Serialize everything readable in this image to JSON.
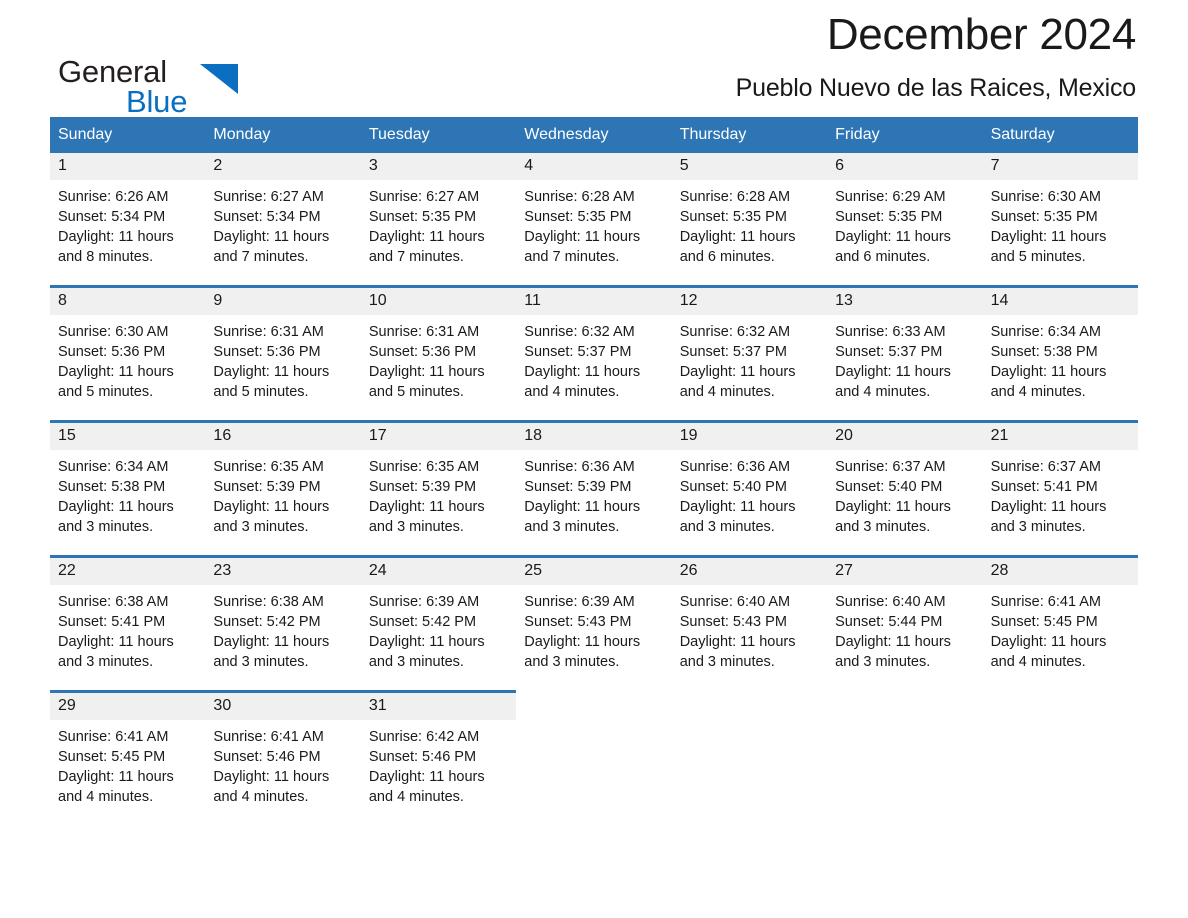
{
  "brand": {
    "name_part1": "General",
    "name_part2": "Blue",
    "logo_icon": "triangle-flag-icon",
    "accent_color": "#0a6ec1"
  },
  "header": {
    "title": "December 2024",
    "location": "Pueblo Nuevo de las Raices, Mexico"
  },
  "calendar": {
    "header_color": "#2e75b6",
    "daynum_band_color": "#f0f0f0",
    "weekdays": [
      "Sunday",
      "Monday",
      "Tuesday",
      "Wednesday",
      "Thursday",
      "Friday",
      "Saturday"
    ],
    "weeks": [
      [
        {
          "day": "1",
          "sunrise": "Sunrise: 6:26 AM",
          "sunset": "Sunset: 5:34 PM",
          "daylight_line1": "Daylight: 11 hours",
          "daylight_line2": "and 8 minutes."
        },
        {
          "day": "2",
          "sunrise": "Sunrise: 6:27 AM",
          "sunset": "Sunset: 5:34 PM",
          "daylight_line1": "Daylight: 11 hours",
          "daylight_line2": "and 7 minutes."
        },
        {
          "day": "3",
          "sunrise": "Sunrise: 6:27 AM",
          "sunset": "Sunset: 5:35 PM",
          "daylight_line1": "Daylight: 11 hours",
          "daylight_line2": "and 7 minutes."
        },
        {
          "day": "4",
          "sunrise": "Sunrise: 6:28 AM",
          "sunset": "Sunset: 5:35 PM",
          "daylight_line1": "Daylight: 11 hours",
          "daylight_line2": "and 7 minutes."
        },
        {
          "day": "5",
          "sunrise": "Sunrise: 6:28 AM",
          "sunset": "Sunset: 5:35 PM",
          "daylight_line1": "Daylight: 11 hours",
          "daylight_line2": "and 6 minutes."
        },
        {
          "day": "6",
          "sunrise": "Sunrise: 6:29 AM",
          "sunset": "Sunset: 5:35 PM",
          "daylight_line1": "Daylight: 11 hours",
          "daylight_line2": "and 6 minutes."
        },
        {
          "day": "7",
          "sunrise": "Sunrise: 6:30 AM",
          "sunset": "Sunset: 5:35 PM",
          "daylight_line1": "Daylight: 11 hours",
          "daylight_line2": "and 5 minutes."
        }
      ],
      [
        {
          "day": "8",
          "sunrise": "Sunrise: 6:30 AM",
          "sunset": "Sunset: 5:36 PM",
          "daylight_line1": "Daylight: 11 hours",
          "daylight_line2": "and 5 minutes."
        },
        {
          "day": "9",
          "sunrise": "Sunrise: 6:31 AM",
          "sunset": "Sunset: 5:36 PM",
          "daylight_line1": "Daylight: 11 hours",
          "daylight_line2": "and 5 minutes."
        },
        {
          "day": "10",
          "sunrise": "Sunrise: 6:31 AM",
          "sunset": "Sunset: 5:36 PM",
          "daylight_line1": "Daylight: 11 hours",
          "daylight_line2": "and 5 minutes."
        },
        {
          "day": "11",
          "sunrise": "Sunrise: 6:32 AM",
          "sunset": "Sunset: 5:37 PM",
          "daylight_line1": "Daylight: 11 hours",
          "daylight_line2": "and 4 minutes."
        },
        {
          "day": "12",
          "sunrise": "Sunrise: 6:32 AM",
          "sunset": "Sunset: 5:37 PM",
          "daylight_line1": "Daylight: 11 hours",
          "daylight_line2": "and 4 minutes."
        },
        {
          "day": "13",
          "sunrise": "Sunrise: 6:33 AM",
          "sunset": "Sunset: 5:37 PM",
          "daylight_line1": "Daylight: 11 hours",
          "daylight_line2": "and 4 minutes."
        },
        {
          "day": "14",
          "sunrise": "Sunrise: 6:34 AM",
          "sunset": "Sunset: 5:38 PM",
          "daylight_line1": "Daylight: 11 hours",
          "daylight_line2": "and 4 minutes."
        }
      ],
      [
        {
          "day": "15",
          "sunrise": "Sunrise: 6:34 AM",
          "sunset": "Sunset: 5:38 PM",
          "daylight_line1": "Daylight: 11 hours",
          "daylight_line2": "and 3 minutes."
        },
        {
          "day": "16",
          "sunrise": "Sunrise: 6:35 AM",
          "sunset": "Sunset: 5:39 PM",
          "daylight_line1": "Daylight: 11 hours",
          "daylight_line2": "and 3 minutes."
        },
        {
          "day": "17",
          "sunrise": "Sunrise: 6:35 AM",
          "sunset": "Sunset: 5:39 PM",
          "daylight_line1": "Daylight: 11 hours",
          "daylight_line2": "and 3 minutes."
        },
        {
          "day": "18",
          "sunrise": "Sunrise: 6:36 AM",
          "sunset": "Sunset: 5:39 PM",
          "daylight_line1": "Daylight: 11 hours",
          "daylight_line2": "and 3 minutes."
        },
        {
          "day": "19",
          "sunrise": "Sunrise: 6:36 AM",
          "sunset": "Sunset: 5:40 PM",
          "daylight_line1": "Daylight: 11 hours",
          "daylight_line2": "and 3 minutes."
        },
        {
          "day": "20",
          "sunrise": "Sunrise: 6:37 AM",
          "sunset": "Sunset: 5:40 PM",
          "daylight_line1": "Daylight: 11 hours",
          "daylight_line2": "and 3 minutes."
        },
        {
          "day": "21",
          "sunrise": "Sunrise: 6:37 AM",
          "sunset": "Sunset: 5:41 PM",
          "daylight_line1": "Daylight: 11 hours",
          "daylight_line2": "and 3 minutes."
        }
      ],
      [
        {
          "day": "22",
          "sunrise": "Sunrise: 6:38 AM",
          "sunset": "Sunset: 5:41 PM",
          "daylight_line1": "Daylight: 11 hours",
          "daylight_line2": "and 3 minutes."
        },
        {
          "day": "23",
          "sunrise": "Sunrise: 6:38 AM",
          "sunset": "Sunset: 5:42 PM",
          "daylight_line1": "Daylight: 11 hours",
          "daylight_line2": "and 3 minutes."
        },
        {
          "day": "24",
          "sunrise": "Sunrise: 6:39 AM",
          "sunset": "Sunset: 5:42 PM",
          "daylight_line1": "Daylight: 11 hours",
          "daylight_line2": "and 3 minutes."
        },
        {
          "day": "25",
          "sunrise": "Sunrise: 6:39 AM",
          "sunset": "Sunset: 5:43 PM",
          "daylight_line1": "Daylight: 11 hours",
          "daylight_line2": "and 3 minutes."
        },
        {
          "day": "26",
          "sunrise": "Sunrise: 6:40 AM",
          "sunset": "Sunset: 5:43 PM",
          "daylight_line1": "Daylight: 11 hours",
          "daylight_line2": "and 3 minutes."
        },
        {
          "day": "27",
          "sunrise": "Sunrise: 6:40 AM",
          "sunset": "Sunset: 5:44 PM",
          "daylight_line1": "Daylight: 11 hours",
          "daylight_line2": "and 3 minutes."
        },
        {
          "day": "28",
          "sunrise": "Sunrise: 6:41 AM",
          "sunset": "Sunset: 5:45 PM",
          "daylight_line1": "Daylight: 11 hours",
          "daylight_line2": "and 4 minutes."
        }
      ],
      [
        {
          "day": "29",
          "sunrise": "Sunrise: 6:41 AM",
          "sunset": "Sunset: 5:45 PM",
          "daylight_line1": "Daylight: 11 hours",
          "daylight_line2": "and 4 minutes."
        },
        {
          "day": "30",
          "sunrise": "Sunrise: 6:41 AM",
          "sunset": "Sunset: 5:46 PM",
          "daylight_line1": "Daylight: 11 hours",
          "daylight_line2": "and 4 minutes."
        },
        {
          "day": "31",
          "sunrise": "Sunrise: 6:42 AM",
          "sunset": "Sunset: 5:46 PM",
          "daylight_line1": "Daylight: 11 hours",
          "daylight_line2": "and 4 minutes."
        },
        {
          "day": "",
          "sunrise": "",
          "sunset": "",
          "daylight_line1": "",
          "daylight_line2": ""
        },
        {
          "day": "",
          "sunrise": "",
          "sunset": "",
          "daylight_line1": "",
          "daylight_line2": ""
        },
        {
          "day": "",
          "sunrise": "",
          "sunset": "",
          "daylight_line1": "",
          "daylight_line2": ""
        },
        {
          "day": "",
          "sunrise": "",
          "sunset": "",
          "daylight_line1": "",
          "daylight_line2": ""
        }
      ]
    ]
  }
}
